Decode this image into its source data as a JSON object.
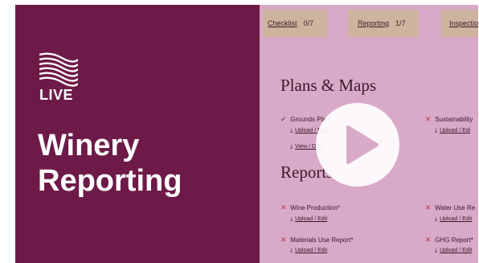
{
  "brand": {
    "live_label": "LIVE",
    "title_line1": "Winery",
    "title_line2": "Reporting"
  },
  "tabs": [
    {
      "label": "Checklist",
      "count": "0/7"
    },
    {
      "label": "Reporting",
      "count": "1/7"
    },
    {
      "label": "Inspectio"
    }
  ],
  "sections": {
    "plans_title": "Plans & Maps",
    "reports_title": "Reports"
  },
  "plans_items": [
    {
      "label": "Grounds Plan*",
      "status": "check",
      "status_glyph": "✓",
      "links": [
        "Upload / Edit",
        "View / Dov"
      ]
    },
    {
      "label": "Sustainability",
      "status": "missing",
      "status_glyph": "✕",
      "links": [
        "Upload / Edi"
      ]
    }
  ],
  "report_items": [
    {
      "label": "Wine Production*",
      "status": "missing",
      "status_glyph": "✕",
      "link": "Upload / Edit"
    },
    {
      "label": "Water Use Re",
      "status": "missing",
      "status_glyph": "✕",
      "link": "Upload / Edit"
    },
    {
      "label": "Materials Use Report*",
      "status": "missing",
      "status_glyph": "✕",
      "link": "Upload / Edit"
    },
    {
      "label": "GHG Report*",
      "status": "missing",
      "status_glyph": "✕",
      "link": "Upload / Edit"
    }
  ],
  "link_glyph": "⤓",
  "colors": {
    "brand_purple": "#6e1a48",
    "screen_pink": "#d9a9c8",
    "tab_tan": "#ceb49f",
    "missing_red": "#c23a4a"
  },
  "icons": {
    "logo": "wave-logo-icon",
    "play": "play-icon",
    "check": "check-icon",
    "missing": "close-icon",
    "upload": "upload-icon"
  }
}
